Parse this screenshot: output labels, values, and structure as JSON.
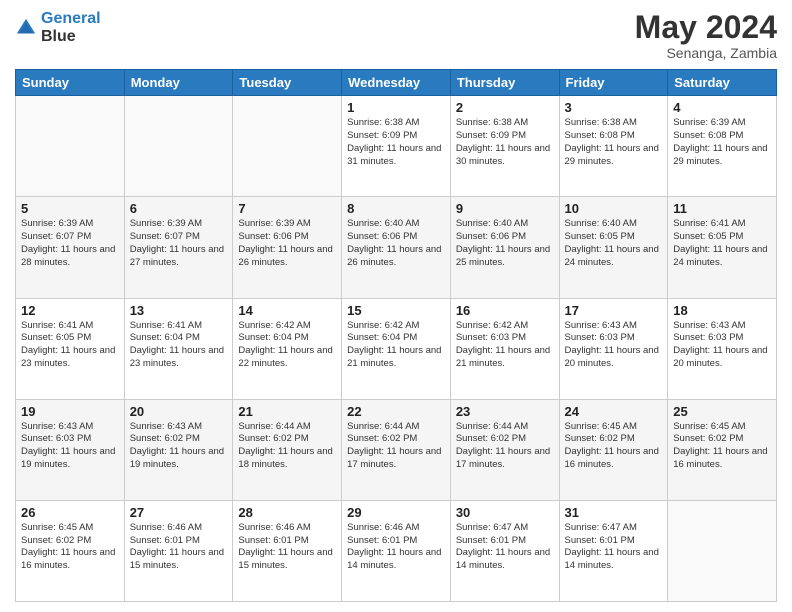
{
  "header": {
    "logo_line1": "General",
    "logo_line2": "Blue",
    "title": "May 2024",
    "location": "Senanga, Zambia"
  },
  "days_of_week": [
    "Sunday",
    "Monday",
    "Tuesday",
    "Wednesday",
    "Thursday",
    "Friday",
    "Saturday"
  ],
  "weeks": [
    [
      {
        "day": "",
        "sunrise": "",
        "sunset": "",
        "daylight": ""
      },
      {
        "day": "",
        "sunrise": "",
        "sunset": "",
        "daylight": ""
      },
      {
        "day": "",
        "sunrise": "",
        "sunset": "",
        "daylight": ""
      },
      {
        "day": "1",
        "sunrise": "Sunrise: 6:38 AM",
        "sunset": "Sunset: 6:09 PM",
        "daylight": "Daylight: 11 hours and 31 minutes."
      },
      {
        "day": "2",
        "sunrise": "Sunrise: 6:38 AM",
        "sunset": "Sunset: 6:09 PM",
        "daylight": "Daylight: 11 hours and 30 minutes."
      },
      {
        "day": "3",
        "sunrise": "Sunrise: 6:38 AM",
        "sunset": "Sunset: 6:08 PM",
        "daylight": "Daylight: 11 hours and 29 minutes."
      },
      {
        "day": "4",
        "sunrise": "Sunrise: 6:39 AM",
        "sunset": "Sunset: 6:08 PM",
        "daylight": "Daylight: 11 hours and 29 minutes."
      }
    ],
    [
      {
        "day": "5",
        "sunrise": "Sunrise: 6:39 AM",
        "sunset": "Sunset: 6:07 PM",
        "daylight": "Daylight: 11 hours and 28 minutes."
      },
      {
        "day": "6",
        "sunrise": "Sunrise: 6:39 AM",
        "sunset": "Sunset: 6:07 PM",
        "daylight": "Daylight: 11 hours and 27 minutes."
      },
      {
        "day": "7",
        "sunrise": "Sunrise: 6:39 AM",
        "sunset": "Sunset: 6:06 PM",
        "daylight": "Daylight: 11 hours and 26 minutes."
      },
      {
        "day": "8",
        "sunrise": "Sunrise: 6:40 AM",
        "sunset": "Sunset: 6:06 PM",
        "daylight": "Daylight: 11 hours and 26 minutes."
      },
      {
        "day": "9",
        "sunrise": "Sunrise: 6:40 AM",
        "sunset": "Sunset: 6:06 PM",
        "daylight": "Daylight: 11 hours and 25 minutes."
      },
      {
        "day": "10",
        "sunrise": "Sunrise: 6:40 AM",
        "sunset": "Sunset: 6:05 PM",
        "daylight": "Daylight: 11 hours and 24 minutes."
      },
      {
        "day": "11",
        "sunrise": "Sunrise: 6:41 AM",
        "sunset": "Sunset: 6:05 PM",
        "daylight": "Daylight: 11 hours and 24 minutes."
      }
    ],
    [
      {
        "day": "12",
        "sunrise": "Sunrise: 6:41 AM",
        "sunset": "Sunset: 6:05 PM",
        "daylight": "Daylight: 11 hours and 23 minutes."
      },
      {
        "day": "13",
        "sunrise": "Sunrise: 6:41 AM",
        "sunset": "Sunset: 6:04 PM",
        "daylight": "Daylight: 11 hours and 23 minutes."
      },
      {
        "day": "14",
        "sunrise": "Sunrise: 6:42 AM",
        "sunset": "Sunset: 6:04 PM",
        "daylight": "Daylight: 11 hours and 22 minutes."
      },
      {
        "day": "15",
        "sunrise": "Sunrise: 6:42 AM",
        "sunset": "Sunset: 6:04 PM",
        "daylight": "Daylight: 11 hours and 21 minutes."
      },
      {
        "day": "16",
        "sunrise": "Sunrise: 6:42 AM",
        "sunset": "Sunset: 6:03 PM",
        "daylight": "Daylight: 11 hours and 21 minutes."
      },
      {
        "day": "17",
        "sunrise": "Sunrise: 6:43 AM",
        "sunset": "Sunset: 6:03 PM",
        "daylight": "Daylight: 11 hours and 20 minutes."
      },
      {
        "day": "18",
        "sunrise": "Sunrise: 6:43 AM",
        "sunset": "Sunset: 6:03 PM",
        "daylight": "Daylight: 11 hours and 20 minutes."
      }
    ],
    [
      {
        "day": "19",
        "sunrise": "Sunrise: 6:43 AM",
        "sunset": "Sunset: 6:03 PM",
        "daylight": "Daylight: 11 hours and 19 minutes."
      },
      {
        "day": "20",
        "sunrise": "Sunrise: 6:43 AM",
        "sunset": "Sunset: 6:02 PM",
        "daylight": "Daylight: 11 hours and 19 minutes."
      },
      {
        "day": "21",
        "sunrise": "Sunrise: 6:44 AM",
        "sunset": "Sunset: 6:02 PM",
        "daylight": "Daylight: 11 hours and 18 minutes."
      },
      {
        "day": "22",
        "sunrise": "Sunrise: 6:44 AM",
        "sunset": "Sunset: 6:02 PM",
        "daylight": "Daylight: 11 hours and 17 minutes."
      },
      {
        "day": "23",
        "sunrise": "Sunrise: 6:44 AM",
        "sunset": "Sunset: 6:02 PM",
        "daylight": "Daylight: 11 hours and 17 minutes."
      },
      {
        "day": "24",
        "sunrise": "Sunrise: 6:45 AM",
        "sunset": "Sunset: 6:02 PM",
        "daylight": "Daylight: 11 hours and 16 minutes."
      },
      {
        "day": "25",
        "sunrise": "Sunrise: 6:45 AM",
        "sunset": "Sunset: 6:02 PM",
        "daylight": "Daylight: 11 hours and 16 minutes."
      }
    ],
    [
      {
        "day": "26",
        "sunrise": "Sunrise: 6:45 AM",
        "sunset": "Sunset: 6:02 PM",
        "daylight": "Daylight: 11 hours and 16 minutes."
      },
      {
        "day": "27",
        "sunrise": "Sunrise: 6:46 AM",
        "sunset": "Sunset: 6:01 PM",
        "daylight": "Daylight: 11 hours and 15 minutes."
      },
      {
        "day": "28",
        "sunrise": "Sunrise: 6:46 AM",
        "sunset": "Sunset: 6:01 PM",
        "daylight": "Daylight: 11 hours and 15 minutes."
      },
      {
        "day": "29",
        "sunrise": "Sunrise: 6:46 AM",
        "sunset": "Sunset: 6:01 PM",
        "daylight": "Daylight: 11 hours and 14 minutes."
      },
      {
        "day": "30",
        "sunrise": "Sunrise: 6:47 AM",
        "sunset": "Sunset: 6:01 PM",
        "daylight": "Daylight: 11 hours and 14 minutes."
      },
      {
        "day": "31",
        "sunrise": "Sunrise: 6:47 AM",
        "sunset": "Sunset: 6:01 PM",
        "daylight": "Daylight: 11 hours and 14 minutes."
      },
      {
        "day": "",
        "sunrise": "",
        "sunset": "",
        "daylight": ""
      }
    ]
  ]
}
